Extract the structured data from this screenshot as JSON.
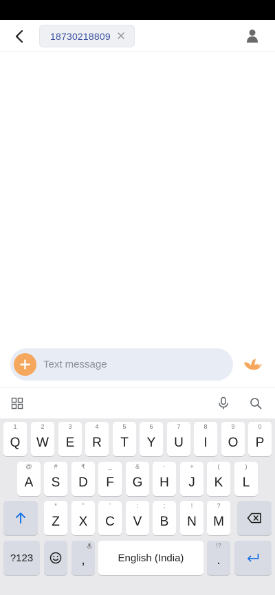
{
  "header": {
    "back_icon": "back-arrow-icon",
    "recipient": "18730218809",
    "chip_close": "×",
    "contact_icon": "person-icon"
  },
  "compose": {
    "placeholder": "Text message",
    "add_icon": "plus-icon",
    "send_icon": "bird-send-icon"
  },
  "keyboard_toolbar": {
    "left_icon": "apps-grid-icon",
    "mic_icon": "mic-icon",
    "search_icon": "search-icon"
  },
  "keyboard": {
    "row1": [
      {
        "main": "Q",
        "sub": "1"
      },
      {
        "main": "W",
        "sub": "2"
      },
      {
        "main": "E",
        "sub": "3"
      },
      {
        "main": "R",
        "sub": "4"
      },
      {
        "main": "T",
        "sub": "5"
      },
      {
        "main": "Y",
        "sub": "6"
      },
      {
        "main": "U",
        "sub": "7"
      },
      {
        "main": "I",
        "sub": "8"
      },
      {
        "main": "O",
        "sub": "9"
      },
      {
        "main": "P",
        "sub": "0"
      }
    ],
    "row2": [
      {
        "main": "A",
        "sub": "@"
      },
      {
        "main": "S",
        "sub": "#"
      },
      {
        "main": "D",
        "sub": "₹"
      },
      {
        "main": "F",
        "sub": "_"
      },
      {
        "main": "G",
        "sub": "&"
      },
      {
        "main": "H",
        "sub": "-"
      },
      {
        "main": "J",
        "sub": "+"
      },
      {
        "main": "K",
        "sub": "("
      },
      {
        "main": "L",
        "sub": ")"
      }
    ],
    "row3": [
      {
        "main": "Z",
        "sub": "*"
      },
      {
        "main": "X",
        "sub": "\""
      },
      {
        "main": "C",
        "sub": "'"
      },
      {
        "main": "V",
        "sub": ":"
      },
      {
        "main": "B",
        "sub": ";"
      },
      {
        "main": "N",
        "sub": "!"
      },
      {
        "main": "M",
        "sub": "?"
      }
    ],
    "shift_icon": "shift-arrow-icon",
    "backspace_icon": "backspace-icon",
    "symbols_label": "?123",
    "emoji_icon": "emoji-icon",
    "comma": ",",
    "space_label": "English (India)",
    "period": ".",
    "period_sub": "!?",
    "enter_icon": "enter-icon",
    "colors": {
      "accent": "#1a73e8",
      "add_button": "#f6a75e"
    }
  }
}
